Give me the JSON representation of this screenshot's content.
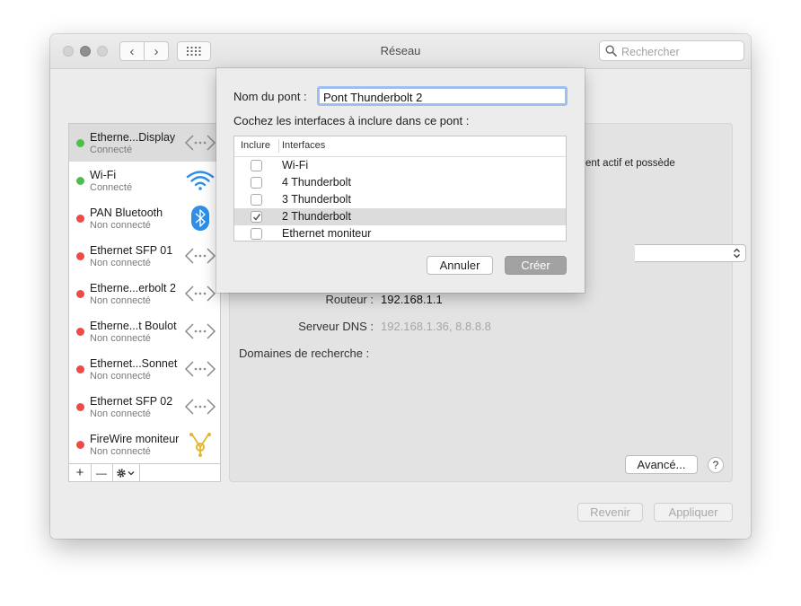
{
  "window": {
    "title": "Réseau"
  },
  "toolbar": {
    "back_glyph": "‹",
    "forward_glyph": "›",
    "grid_icon": "grid-icon"
  },
  "search": {
    "placeholder": "Rechercher"
  },
  "services": [
    {
      "name": "Etherne...Display",
      "status": "Connecté",
      "dot": "#4cbf4c",
      "icon": "ethernet-icon",
      "selected": true
    },
    {
      "name": "Wi-Fi",
      "status": "Connecté",
      "dot": "#4cbf4c",
      "icon": "wifi-icon",
      "selected": false
    },
    {
      "name": "PAN Bluetooth",
      "status": "Non connecté",
      "dot": "#ee4b48",
      "icon": "bluetooth-icon",
      "selected": false
    },
    {
      "name": "Ethernet SFP 01",
      "status": "Non connecté",
      "dot": "#ee4b48",
      "icon": "ethernet-icon",
      "selected": false
    },
    {
      "name": "Etherne...erbolt 2",
      "status": "Non connecté",
      "dot": "#ee4b48",
      "icon": "ethernet-icon",
      "selected": false
    },
    {
      "name": "Etherne...t Boulot",
      "status": "Non connecté",
      "dot": "#ee4b48",
      "icon": "ethernet-icon",
      "selected": false
    },
    {
      "name": "Ethernet...Sonnet",
      "status": "Non connecté",
      "dot": "#ee4b48",
      "icon": "ethernet-icon",
      "selected": false
    },
    {
      "name": "Ethernet SFP 02",
      "status": "Non connecté",
      "dot": "#ee4b48",
      "icon": "ethernet-icon",
      "selected": false
    },
    {
      "name": "FireWire moniteur",
      "status": "Non connecté",
      "dot": "#ee4b48",
      "icon": "firewire-icon",
      "selected": false
    }
  ],
  "sidebar_toolbar": {
    "add": "+",
    "remove": "—"
  },
  "details": {
    "partial_text": "ent actif et possède",
    "router_label": "Routeur :",
    "router_value": "192.168.1.1",
    "dns_label": "Serveur DNS :",
    "dns_value": "192.168.1.36, 8.8.8.8",
    "domains_label": "Domaines de recherche :",
    "advanced": "Avancé...",
    "help": "?",
    "revert": "Revenir",
    "apply": "Appliquer"
  },
  "sheet": {
    "name_label": "Nom du pont :",
    "name_value": "Pont Thunderbolt 2",
    "instructions": "Cochez les interfaces à inclure dans ce pont :",
    "col_include": "Inclure",
    "col_interfaces": "Interfaces",
    "interfaces": [
      {
        "name": "Wi-Fi",
        "checked": false
      },
      {
        "name": "4 Thunderbolt",
        "checked": false
      },
      {
        "name": "3 Thunderbolt",
        "checked": false
      },
      {
        "name": "2 Thunderbolt",
        "checked": true
      },
      {
        "name": "Ethernet moniteur",
        "checked": false
      }
    ],
    "cancel": "Annuler",
    "create": "Créer"
  }
}
